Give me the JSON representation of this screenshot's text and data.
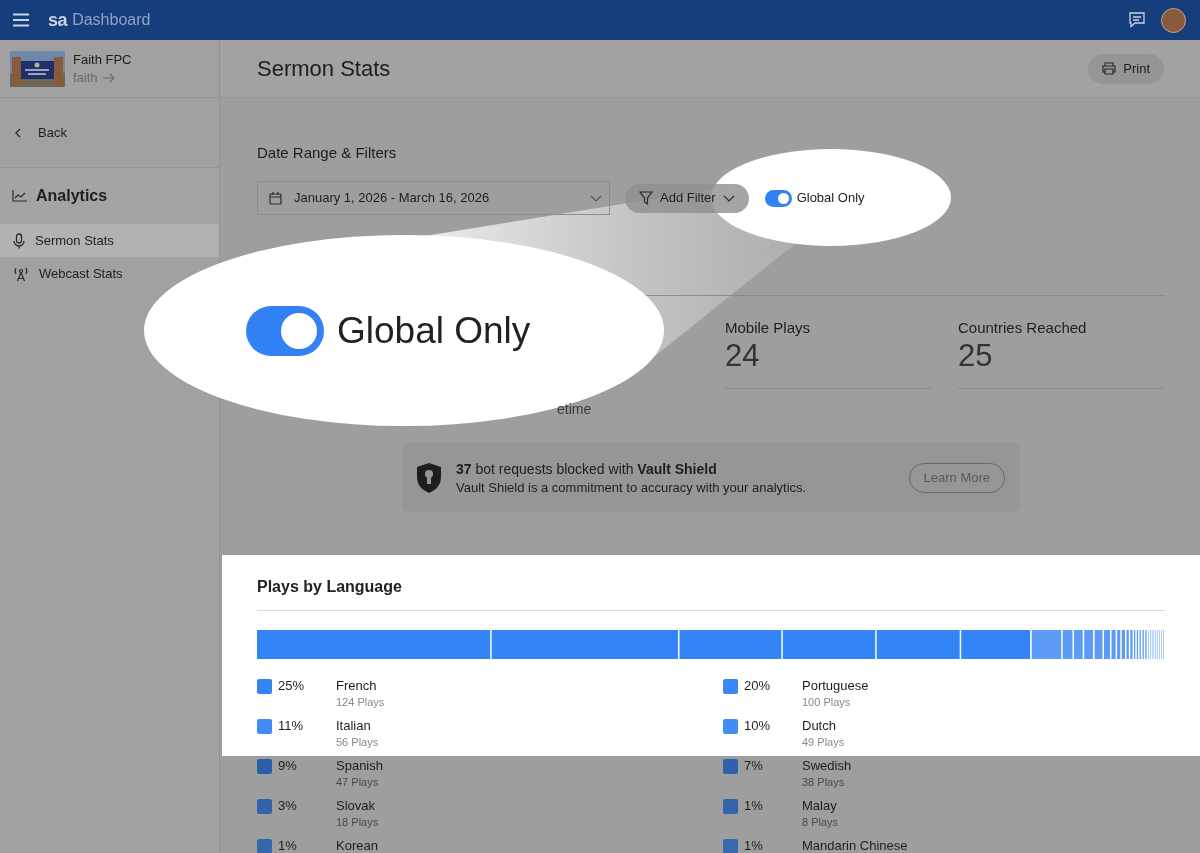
{
  "header": {
    "logo": "sa",
    "title": "Dashboard"
  },
  "sidebar": {
    "org_name": "Faith FPC",
    "org_slug": "faith",
    "back": "Back",
    "section": "Analytics",
    "items": [
      {
        "label": "Sermon Stats",
        "selected": true
      },
      {
        "label": "Webcast Stats",
        "selected": false
      }
    ]
  },
  "page": {
    "title": "Sermon Stats",
    "print": "Print"
  },
  "filters": {
    "heading": "Date Range & Filters",
    "date_range": "January 1, 2026 - March 16, 2026",
    "add_filter": "Add Filter",
    "global_only": {
      "label": "Global Only",
      "on": true
    }
  },
  "callout": {
    "label": "Global Only",
    "on": true
  },
  "stats": [
    {
      "label": "Mobile Plays",
      "value": "24"
    },
    {
      "label": "Countries Reached",
      "value": "25"
    }
  ],
  "stats_note": "etime",
  "vault": {
    "count": "37",
    "text": " bot requests blocked with ",
    "brand": "Vault Shield",
    "sub": "Vault Shield is a commitment to accuracy with your analytics.",
    "button": "Learn More"
  },
  "languages": {
    "title": "Plays by Language",
    "items": [
      {
        "percent": "25%",
        "name": "French",
        "plays": "124 Plays",
        "color": "#3385f5"
      },
      {
        "percent": "20%",
        "name": "Portuguese",
        "plays": "100 Plays",
        "color": "#3a88f5"
      },
      {
        "percent": "11%",
        "name": "Italian",
        "plays": "56 Plays",
        "color": "#3f8cf6"
      },
      {
        "percent": "10%",
        "name": "Dutch",
        "plays": "49 Plays",
        "color": "#438ef6"
      },
      {
        "percent": "9%",
        "name": "Spanish",
        "plays": "47 Plays",
        "color": "#2d5ea8"
      },
      {
        "percent": "7%",
        "name": "Swedish",
        "plays": "38 Plays",
        "color": "#2f60a9"
      },
      {
        "percent": "3%",
        "name": "Slovak",
        "plays": "18 Plays",
        "color": "#3263aa"
      },
      {
        "percent": "1%",
        "name": "Malay",
        "plays": "8 Plays",
        "color": "#3465ab"
      },
      {
        "percent": "1%",
        "name": "Korean",
        "color": "#3667ac"
      },
      {
        "percent": "1%",
        "name": "Mandarin Chinese",
        "color": "#3869ad"
      }
    ]
  }
}
